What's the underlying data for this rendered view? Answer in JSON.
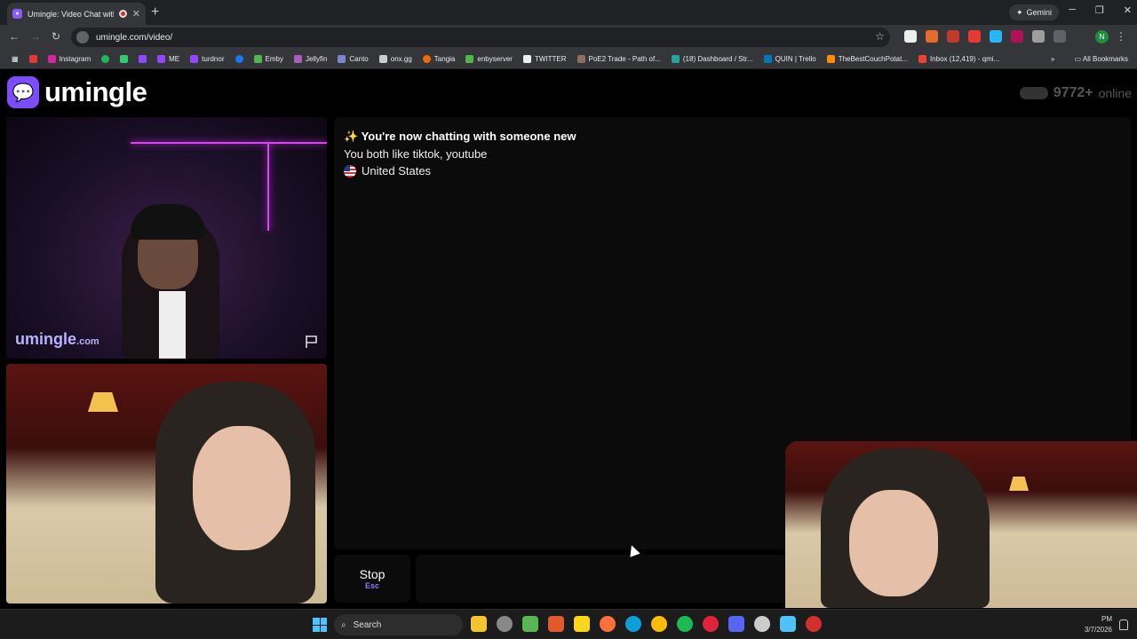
{
  "browser": {
    "tab_title": "Umingle: Video Chat with S",
    "new_tab": "+",
    "gemini_label": "Gemini",
    "url": "umingle.com/video/",
    "bookmarks": [
      "Instagram",
      "ME",
      "turdnor",
      "Emby",
      "Jellyfin",
      "Canto",
      "onx.gg",
      "Tangia",
      "enbyserver",
      "TWITTER",
      "PoE2 Trade - Path of...",
      "(18) Dashboard / Str...",
      "QUIN | Trello",
      "TheBestCouchPotat...",
      "Inbox (12,419) - qmi..."
    ],
    "all_bookmarks": "All Bookmarks",
    "profile_initial": "N"
  },
  "site": {
    "brand": "umingle",
    "online_count": "9772+",
    "online_label": "online",
    "watermark": "umingle",
    "watermark_suffix": ".com"
  },
  "chat": {
    "status": "✨ You're now chatting with someone new",
    "interests": "You both like tiktok, youtube",
    "country": "United States"
  },
  "controls": {
    "stop_label": "Stop",
    "stop_hint": "Esc"
  },
  "taskbar": {
    "search_label": "Search",
    "time": "PM",
    "date": "3/7/2026"
  },
  "colors": {
    "brand": "#7c4dff",
    "accent_hint": "#8a7dff",
    "neon": "#e040fb"
  }
}
